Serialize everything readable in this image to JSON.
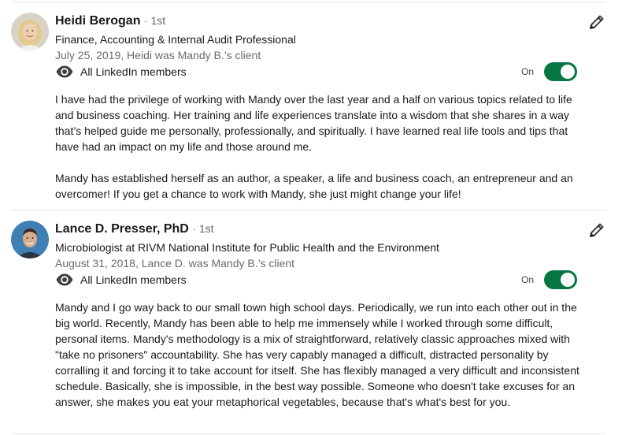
{
  "recommendations": [
    {
      "name": "Heidi Berogan",
      "degree": "· 1st",
      "headline": "Finance, Accounting & Internal Audit Professional",
      "meta": "July 25, 2019, Heidi was Mandy B.’s client",
      "visibility": "All LinkedIn members",
      "toggle_label": "On",
      "toggle_on": true,
      "paragraphs": [
        "I have had the privilege of working with Mandy over the last year and a half on various topics related to life and business coaching. Her training and life experiences translate into a wisdom that she shares in a way that’s helped guide me personally, professionally, and spiritually. I have learned real life tools and tips that have had an impact on my life and those around me.",
        "Mandy has established herself as an author, a speaker, a life and business coach, an entrepreneur and an overcomer! If you get a chance to work with Mandy, she just might change your life!"
      ]
    },
    {
      "name": "Lance D. Presser, PhD",
      "degree": "· 1st",
      "headline": "Microbiologist at RIVM National Institute for Public Health and the Environment",
      "meta": "August 31, 2018, Lance D. was Mandy B.’s client",
      "visibility": "All LinkedIn members",
      "toggle_label": "On",
      "toggle_on": true,
      "paragraphs": [
        "Mandy and I go way back to our small town high school days. Periodically, we run into each other out in the big world. Recently, Mandy has been able to help me immensely while I worked through some difficult, personal items. Mandy's methodology is a mix of straightforward, relatively classic approaches mixed with \"take no prisoners\" accountability. She has very capably managed a difficult, distracted personality by corralling it and forcing it to take account for itself. She has flexibly managed a very difficult and inconsistent schedule. Basically, she is impossible, in the best way possible. Someone who doesn't take excuses for an answer, she makes you eat your metaphorical vegetables, because that's what's best for you."
      ]
    }
  ],
  "colors": {
    "toggle_on": "#057642",
    "divider": "#e6e6e6"
  },
  "icons": {
    "visibility": "eye-icon",
    "edit": "pencil-icon"
  }
}
